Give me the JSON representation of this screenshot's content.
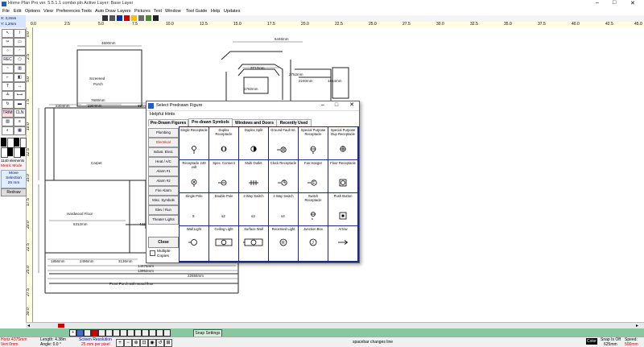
{
  "app": {
    "title": "Home Plan Pro ver. 5.5.1.1   combo.pln        Active Layer: Base Layer"
  },
  "menu": [
    "File",
    "Edit",
    "Options",
    "View",
    "Preferences",
    "Tools",
    "Auto Draw",
    "Layers",
    "Pictures",
    "Text",
    "Window",
    "Tool Guide",
    "Help",
    "Updates"
  ],
  "coords": {
    "x": "X: 3,2mm",
    "y": "Y: 1,2mm"
  },
  "hruler_ticks": [
    "0.0",
    "2.5",
    "5.0",
    "7.5",
    "10.0",
    "12.5",
    "15.0",
    "17.5",
    "20.0",
    "22.5",
    "25.0",
    "27.5",
    "30.0",
    "32.5",
    "35.0",
    "37.5",
    "40.0",
    "42.5",
    "45.0"
  ],
  "vruler_ticks": [
    "0.0",
    "2.5",
    "5.0",
    "7.5",
    "10.0",
    "12.5",
    "15.0",
    "17.5",
    "20.0",
    "22.5",
    "25.0",
    "27.5",
    "30.0"
  ],
  "toolbox": {
    "elements": "1140 elements",
    "mode": "Metric Mode",
    "move": "Move",
    "selection": "Selection",
    "step": "25 mm",
    "redraw": "Redraw"
  },
  "plan_labels": {
    "screened": "Screened",
    "porch": "Porch",
    "carpet": "Carpet",
    "hardwood_floor": "Hardwood Floor",
    "hardwood_floor2": "Hardwood Floor",
    "front_porch": "Front Porch with wood floor",
    "dims": [
      "4600mm",
      "7600mm",
      "2304mm",
      "2304mm",
      "850mm",
      "3712mm",
      "2752mm",
      "2240mm",
      "1864mm",
      "1792mm",
      "5312mm",
      "4224mm",
      "1856mm",
      "2496mm",
      "3136mm",
      "14976mm",
      "13952mm",
      "22656mm",
      "2112mm",
      "3136mm",
      "5376mm",
      "4000mm",
      "5446mm"
    ]
  },
  "dialog": {
    "title": "Select Predrawn Figure",
    "hints": "Helpful Hints",
    "tabs": [
      "Pre-Drawn Figures",
      "Pre-drawn Symbols",
      "Windows and Doors",
      "Recently Used"
    ],
    "active_tab": 1,
    "categories": [
      "Plumbing",
      "Electrical",
      "Indust. Elect.",
      "Heat / A/C",
      "Alarm #1",
      "Alarm #2",
      "Fire Alarm",
      "Misc. Symbols",
      "Elev / Run",
      "Theater Lights"
    ],
    "selected_category": 1,
    "close": "Close",
    "multiple_copies": "Multiple Copies",
    "symbols": [
      {
        "label": "Single Receptacle",
        "icon": "single-receptacle"
      },
      {
        "label": "Duplex Receptacle",
        "icon": "duplex-receptacle"
      },
      {
        "label": "Duplex Split",
        "icon": "duplex-split"
      },
      {
        "label": "Ground Fault Int.",
        "icon": "ground-fault"
      },
      {
        "label": "Special Purpose Receptacle",
        "icon": "special-purpose"
      },
      {
        "label": "Special Purpose Dup Receptacle",
        "icon": "special-purpose-dup"
      },
      {
        "label": "Receptacle 240 volt",
        "icon": "receptacle-240"
      },
      {
        "label": "Spec. Connect",
        "icon": "spec-connect"
      },
      {
        "label": "Multi Outlet",
        "icon": "multi-outlet"
      },
      {
        "label": "Clock Receptacle",
        "icon": "clock-receptacle"
      },
      {
        "label": "Fan Hanger",
        "icon": "fan-hanger"
      },
      {
        "label": "Floor Receptacle",
        "icon": "floor-receptacle"
      },
      {
        "label": "Single Pole",
        "icon": "single-pole"
      },
      {
        "label": "Double Pole",
        "icon": "double-pole"
      },
      {
        "label": "3 Way Switch",
        "icon": "three-way-switch"
      },
      {
        "label": "4 Way Switch",
        "icon": "four-way-switch"
      },
      {
        "label": "Switch Receptacle",
        "icon": "switch-receptacle"
      },
      {
        "label": "Push Button",
        "icon": "push-button"
      },
      {
        "label": "Wall Light",
        "icon": "wall-light"
      },
      {
        "label": "Ceiling Light",
        "icon": "ceiling-light"
      },
      {
        "label": "Surface Wall",
        "icon": "surface-wall"
      },
      {
        "label": "Recessed Light",
        "icon": "recessed-light"
      },
      {
        "label": "Junction Box",
        "icon": "junction-box"
      },
      {
        "label": "Arrow",
        "icon": "arrow"
      }
    ]
  },
  "layer_bar": {
    "snap_settings": "Snap Settings"
  },
  "status": {
    "horiz": "Horiz 4375mm",
    "vert": "Vert 0mm",
    "length": "Length: 4.38m",
    "angle": "Angle: 0.0 °",
    "screen_res": "Screen Resolution",
    "res_value": "25 mm per pixel",
    "hint": "spacebar changes line",
    "color": "Color",
    "snap_label": "Snap Is Off",
    "snap_val": "625mm",
    "speed_label": "Speed:",
    "speed_val": "500mm"
  }
}
